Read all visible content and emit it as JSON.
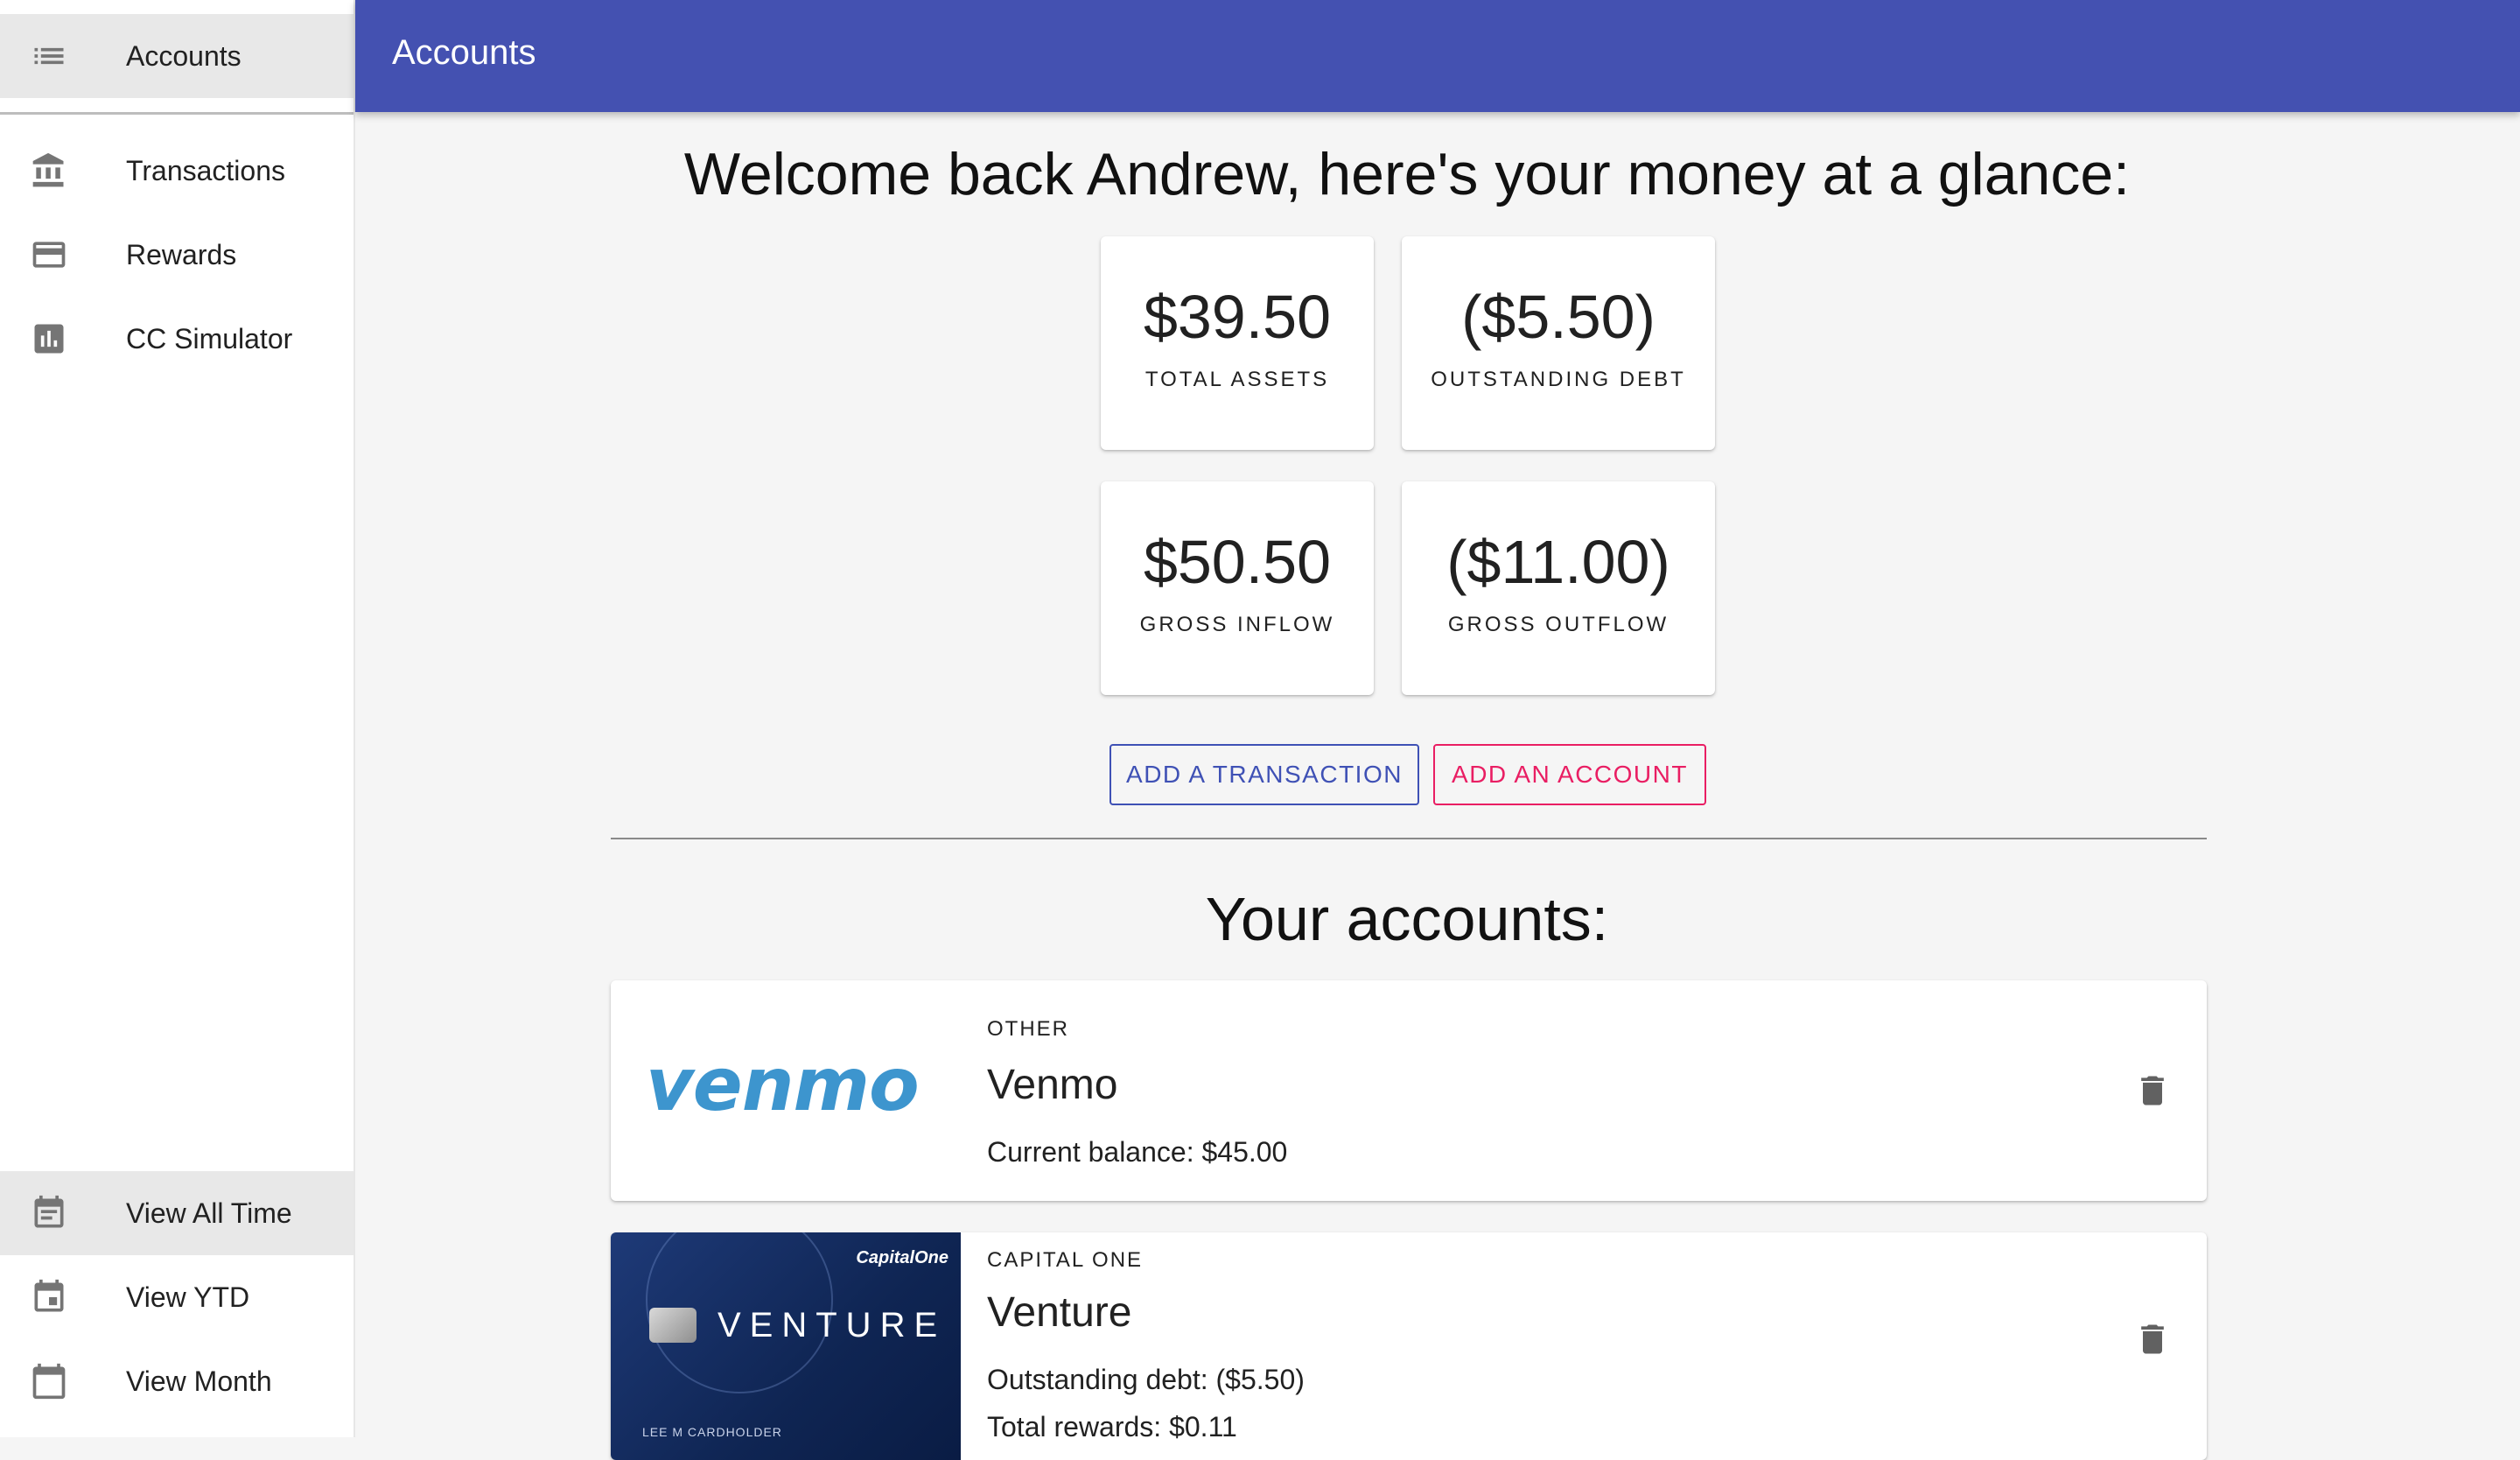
{
  "sidebar": {
    "top_items": [
      {
        "label": "Accounts",
        "icon": "list-icon"
      },
      {
        "label": "Transactions",
        "icon": "bank-icon"
      },
      {
        "label": "Rewards",
        "icon": "credit-card-icon"
      },
      {
        "label": "CC Simulator",
        "icon": "bar-chart-icon"
      }
    ],
    "bottom_items": [
      {
        "label": "View All Time",
        "icon": "event-note-icon"
      },
      {
        "label": "View YTD",
        "icon": "calendar-event-icon"
      },
      {
        "label": "View Month",
        "icon": "calendar-icon"
      }
    ]
  },
  "header": {
    "title": "Accounts"
  },
  "main": {
    "welcome": "Welcome back Andrew, here's your money at a glance:",
    "stats": [
      {
        "value": "$39.50",
        "label": "TOTAL ASSETS"
      },
      {
        "value": "($5.50)",
        "label": "OUTSTANDING DEBT"
      },
      {
        "value": "$50.50",
        "label": "GROSS INFLOW"
      },
      {
        "value": "($11.00)",
        "label": "GROSS OUTFLOW"
      }
    ],
    "buttons": {
      "add_transaction": "ADD A TRANSACTION",
      "add_account": "ADD AN ACCOUNT"
    },
    "accounts_title": "Your accounts:",
    "accounts": [
      {
        "type": "OTHER",
        "name": "Venmo",
        "logo_text": "venmo",
        "line1": "Current balance: $45.00"
      },
      {
        "type": "CAPITAL ONE",
        "name": "Venture",
        "card_brand": "CapitalOne",
        "card_text": "VENTURE",
        "card_holder": "LEE M CARDHOLDER",
        "line1": "Outstanding debt: ($5.50)",
        "line2": "Total rewards: $0.11"
      }
    ]
  },
  "colors": {
    "app_bar": "#4451b1",
    "primary": "#3f51b5",
    "secondary": "#e91e63",
    "venmo": "#3d95ce"
  }
}
